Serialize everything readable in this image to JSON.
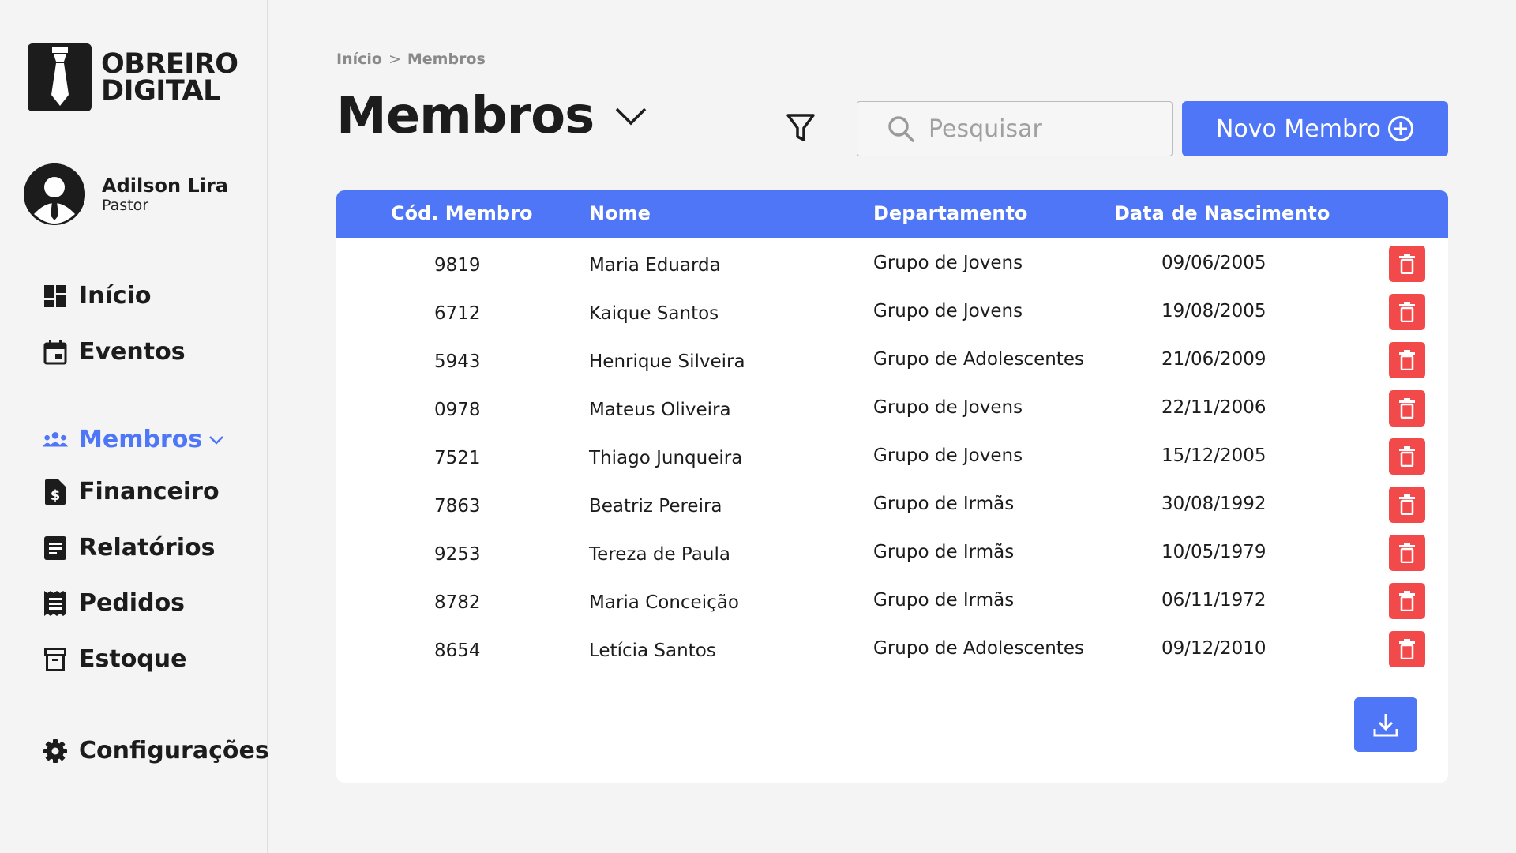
{
  "brand": {
    "line1": "OBREIRO",
    "line2": "DIGITAL"
  },
  "user": {
    "name": "Adilson Lira",
    "role": "Pastor"
  },
  "nav": {
    "inicio": "Início",
    "eventos": "Eventos",
    "membros": "Membros",
    "financeiro": "Financeiro",
    "relatorios": "Relatórios",
    "pedidos": "Pedidos",
    "estoque": "Estoque",
    "configuracoes": "Configurações"
  },
  "breadcrumb": {
    "home": "Início",
    "separator": ">",
    "current": "Membros"
  },
  "page": {
    "title": "Membros"
  },
  "search": {
    "placeholder": "Pesquisar",
    "value": ""
  },
  "actions": {
    "new_member": "Novo Membro"
  },
  "table": {
    "headers": {
      "code": "Cód. Membro",
      "name": "Nome",
      "department": "Departamento",
      "birth": "Data de Nascimento"
    },
    "rows": [
      {
        "code": "9819",
        "name": "Maria Eduarda",
        "department": "Grupo de Jovens",
        "birth": "09/06/2005"
      },
      {
        "code": "6712",
        "name": "Kaique Santos",
        "department": "Grupo de Jovens",
        "birth": "19/08/2005"
      },
      {
        "code": "5943",
        "name": "Henrique Silveira",
        "department": "Grupo de Adolescentes",
        "birth": "21/06/2009"
      },
      {
        "code": "0978",
        "name": "Mateus Oliveira",
        "department": "Grupo de Jovens",
        "birth": "22/11/2006"
      },
      {
        "code": "7521",
        "name": "Thiago Junqueira",
        "department": "Grupo de Jovens",
        "birth": "15/12/2005"
      },
      {
        "code": "7863",
        "name": "Beatriz Pereira",
        "department": "Grupo de Irmãs",
        "birth": "30/08/1992"
      },
      {
        "code": "9253",
        "name": "Tereza de Paula",
        "department": "Grupo de Irmãs",
        "birth": "10/05/1979"
      },
      {
        "code": "8782",
        "name": "Maria Conceição",
        "department": "Grupo de Irmãs",
        "birth": "06/11/1972"
      },
      {
        "code": "8654",
        "name": "Letícia Santos",
        "department": "Grupo de Adolescentes",
        "birth": "09/12/2010"
      }
    ]
  },
  "colors": {
    "accent": "#4f76f6",
    "danger": "#f24a4a",
    "dark": "#1c1c1c",
    "background": "#f4f4f5"
  },
  "icons": {
    "logo": "tie-icon",
    "avatar": "user-avatar-icon",
    "inicio": "dashboard-icon",
    "eventos": "calendar-icon",
    "membros": "group-icon",
    "financeiro": "invoice-dollar-icon",
    "relatorios": "report-icon",
    "pedidos": "receipt-icon",
    "estoque": "archive-box-icon",
    "configuracoes": "gear-icon",
    "filter": "filter-icon",
    "search": "search-icon",
    "add": "plus-circle-icon",
    "delete": "trash-icon",
    "download": "download-icon"
  }
}
